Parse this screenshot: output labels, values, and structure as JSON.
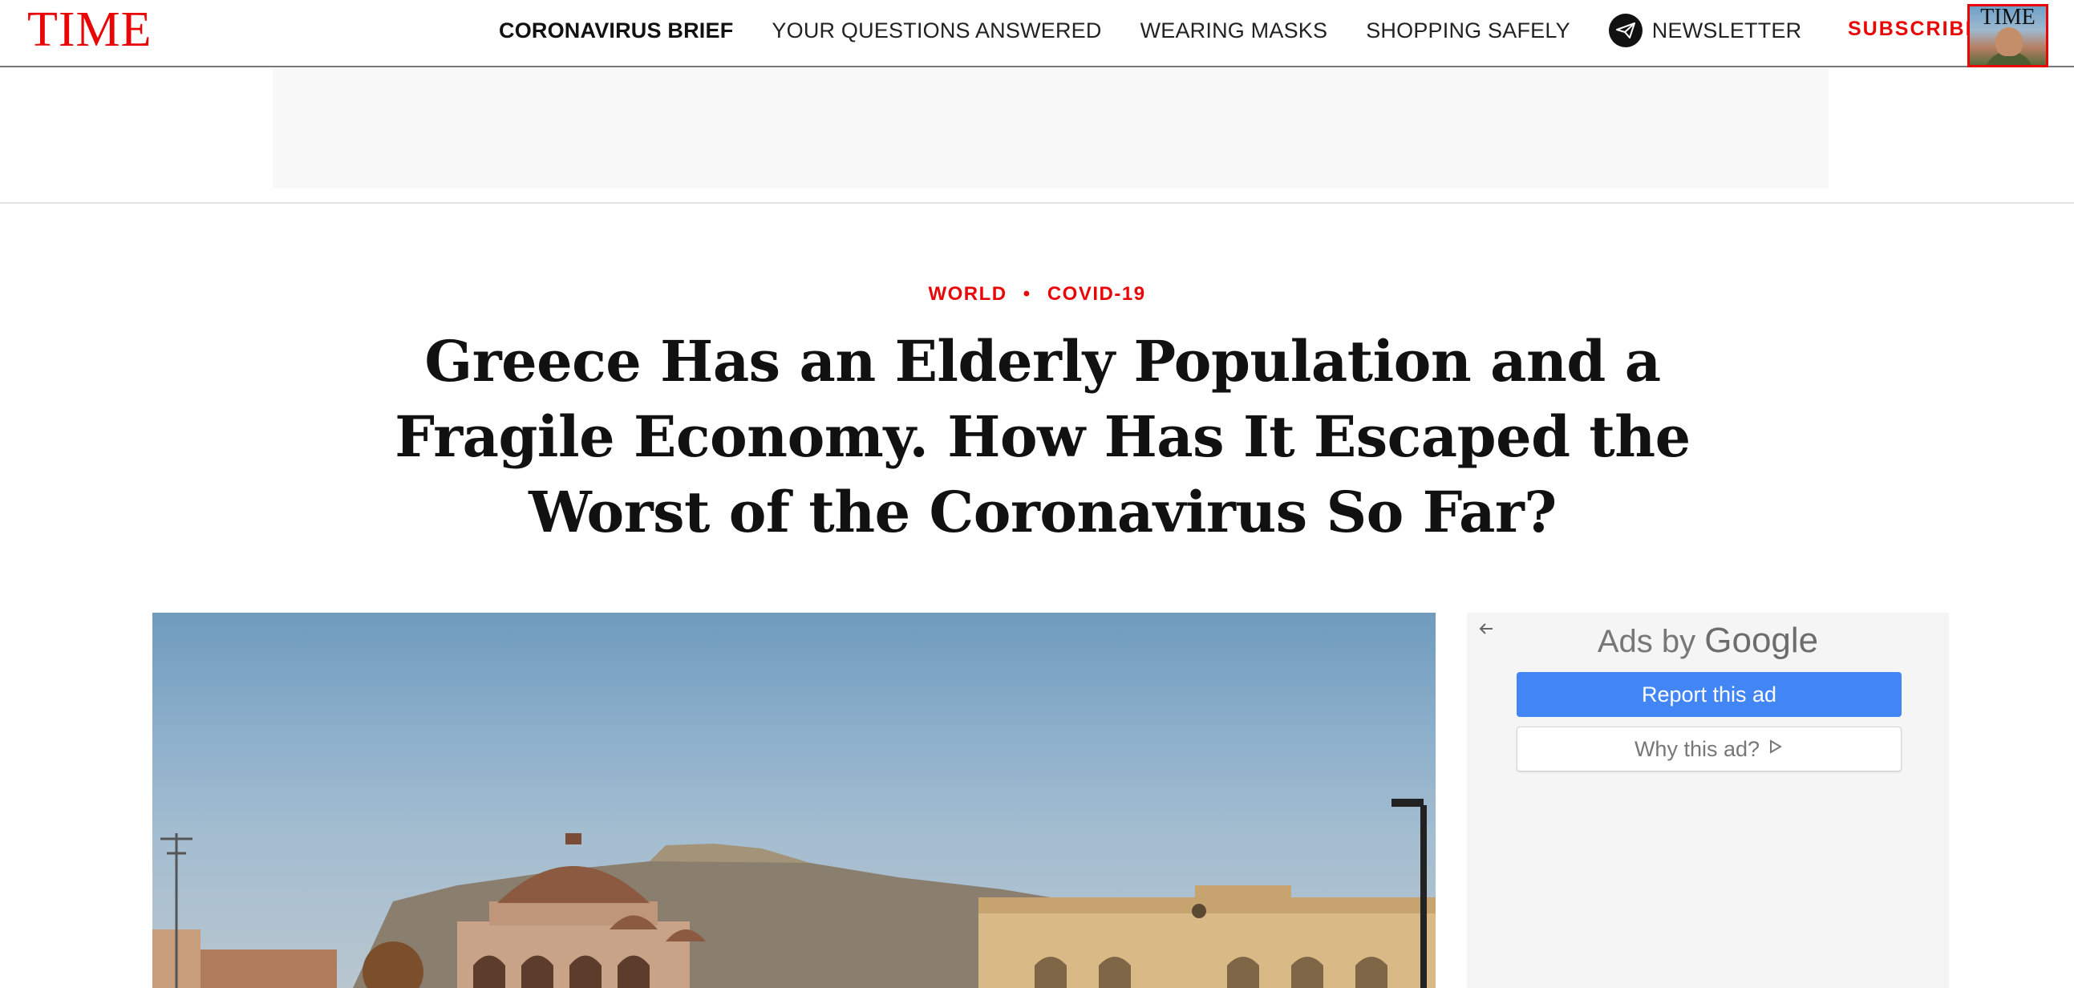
{
  "brand": {
    "logo": "TIME",
    "accent_color": "#e90606"
  },
  "nav": {
    "items": [
      {
        "label": "CORONAVIRUS BRIEF",
        "active": true
      },
      {
        "label": "YOUR QUESTIONS ANSWERED"
      },
      {
        "label": "WEARING MASKS"
      },
      {
        "label": "SHOPPING SAFELY"
      }
    ],
    "newsletter_label": "NEWSLETTER",
    "newsletter_icon": "paper-plane-icon",
    "subscribe_label": "SUBSCRIBE",
    "cover_title": "TIME"
  },
  "article": {
    "kicker_primary": "WORLD",
    "kicker_separator": "•",
    "kicker_secondary": "COVID-19",
    "headline": "Greece Has an Elderly Population and a Fragile Economy. How Has It Escaped the Worst of the Coronavirus So Far?"
  },
  "side_ad": {
    "back_icon": "arrow-left-icon",
    "ads_by": "Ads by",
    "google": "Google",
    "report_label": "Report this ad",
    "why_label": "Why this ad?",
    "why_icon": "play-outline-icon"
  }
}
